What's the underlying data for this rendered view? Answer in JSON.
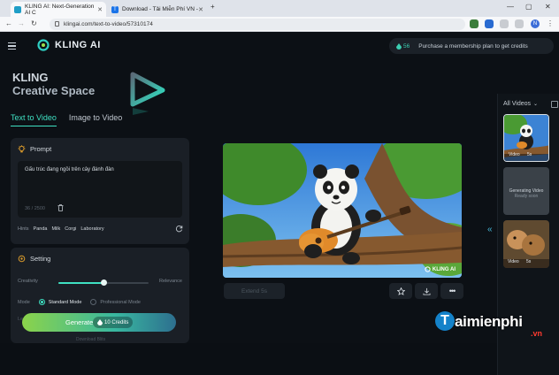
{
  "browser": {
    "tabs": [
      {
        "title": "KLING AI: Next-Generation AI C",
        "active": true,
        "favicon_color": "#1f9ec7"
      },
      {
        "title": "Download - Tải Miễn Phí VN -",
        "active": false,
        "favicon_color": "#1a73e8"
      }
    ],
    "new_tab": "+",
    "url": "klingai.com/text-to-video/57310174",
    "profile_initial": "N"
  },
  "app": {
    "brand": "KLING AI",
    "credits": "56",
    "promo_text": "Purchase a membership plan to get credits"
  },
  "hero": {
    "line1": "KLING",
    "line2": "Creative Space"
  },
  "mode_tabs": [
    {
      "label": "Text to Video",
      "active": true
    },
    {
      "label": "Image to Video",
      "active": false
    }
  ],
  "prompt": {
    "heading": "Prompt",
    "text": "Gấu trúc đang ngồi trên cây đánh đàn",
    "counter": "36 / 2500",
    "hints_label": "Hints",
    "hints": [
      "Panda",
      "Milk",
      "Corgi",
      "Laboratory"
    ]
  },
  "setting": {
    "heading": "Setting",
    "creativity_label": "Creativity",
    "relevance_label": "Relevance",
    "slider_value": 0.5,
    "mode_label": "Mode",
    "modes": [
      {
        "label": "Standard Mode",
        "selected": true
      },
      {
        "label": "Professional Mode",
        "selected": false
      }
    ],
    "length_label": "Le"
  },
  "generate": {
    "label": "Generate",
    "cost": "10 Credits"
  },
  "below_generate": "Download Blits",
  "video": {
    "watermark": "KLING AI",
    "extend_label": "Extend 5s"
  },
  "rail": {
    "heading": "All Videos",
    "items": [
      {
        "label": "Video",
        "duration": "5s",
        "selected": true
      },
      {
        "label": "",
        "duration": "",
        "status": "Generating Video",
        "substatus": "Ready soon",
        "selected": false
      },
      {
        "label": "Video",
        "duration": "5s",
        "selected": false
      }
    ]
  },
  "site_watermark": {
    "name": "aimienphi",
    "initial": "T",
    "tld": ".vn"
  }
}
